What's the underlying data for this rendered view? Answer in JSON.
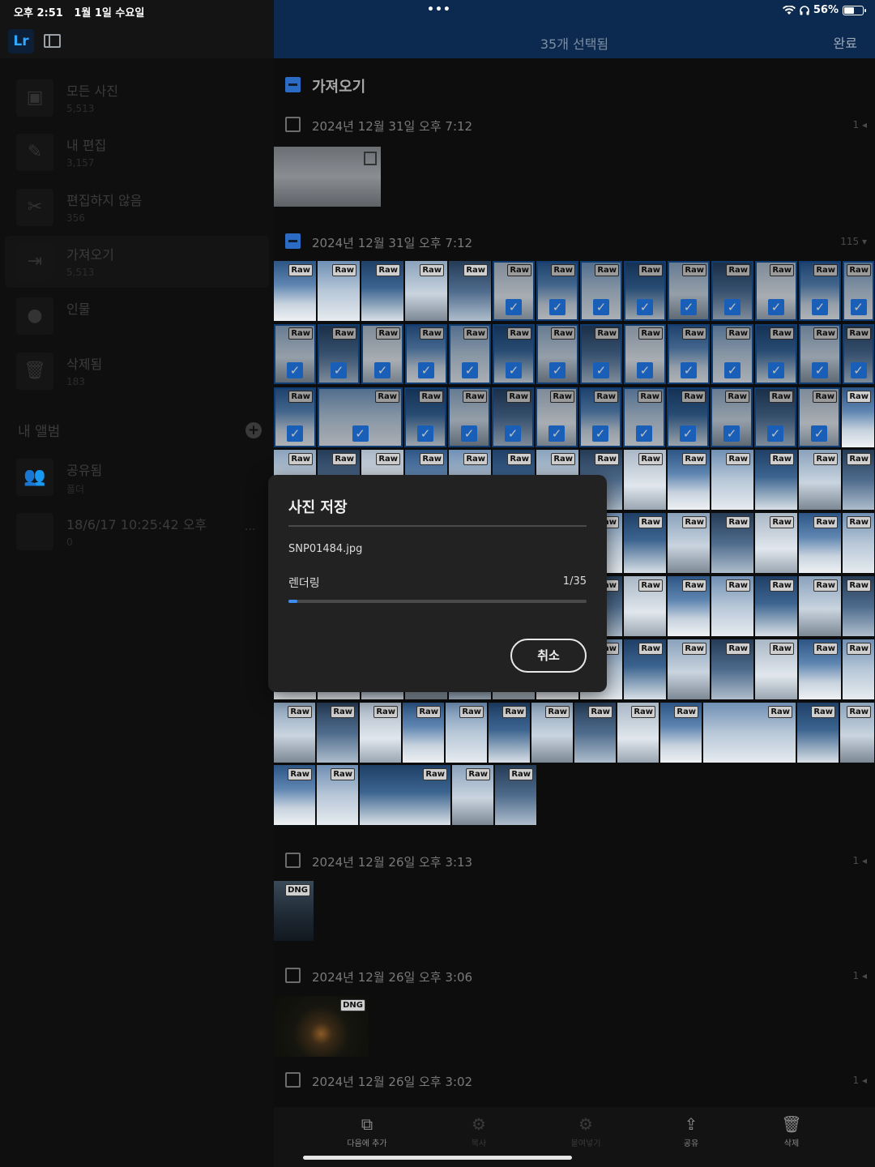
{
  "status_bar": {
    "time": "오후 2:51",
    "date": "1월 1일 수요일",
    "multitask": "•••",
    "battery": "56%",
    "battery_level": 0.56
  },
  "sidebar": {
    "logo": "Lr",
    "items": [
      {
        "label": "모든 사진",
        "count": "5,513",
        "icon": "image-icon",
        "glyph": "▣"
      },
      {
        "label": "내 편집",
        "count": "3,157",
        "icon": "pencil-icon",
        "glyph": "✎"
      },
      {
        "label": "편집하지 않음",
        "count": "356",
        "icon": "no-edit-icon",
        "glyph": "✂"
      },
      {
        "label": "가져오기",
        "count": "5,513",
        "icon": "import-icon",
        "glyph": "⇥"
      },
      {
        "label": "인물",
        "count": "",
        "icon": "person-icon",
        "glyph": "●"
      },
      {
        "label": "삭제됨",
        "count": "183",
        "icon": "trash-icon",
        "glyph": "🗑"
      }
    ],
    "albums_header": "내 앨범",
    "albums": [
      {
        "label": "공유됨",
        "count": "폴더",
        "icon": "shared-icon",
        "glyph": "👥"
      },
      {
        "label": "18/6/17 10:25:42 오후",
        "count": "0",
        "icon": "album-thumb",
        "glyph": ""
      }
    ]
  },
  "header": {
    "title": "35개 선택됨",
    "done": "완료"
  },
  "sections": {
    "import_title": "가져오기",
    "s1": {
      "title": "2024년 12월 31일 오후 7:12",
      "count": "1"
    },
    "s2": {
      "title": "2024년 12월 31일 오후 7:12",
      "count": "115"
    },
    "s3": {
      "title": "2024년 12월 26일 오후 3:13",
      "count": "1"
    },
    "s4": {
      "title": "2024년 12월 26일 오후 3:06",
      "count": "1"
    },
    "s5": {
      "title": "2024년 12월 26일 오후 3:02",
      "count": "1"
    }
  },
  "badges": {
    "raw": "Raw",
    "dng": "DNG"
  },
  "dialog": {
    "title": "사진 저장",
    "filename": "SNP01484.jpg",
    "status": "렌더링",
    "progress_text": "1/35",
    "progress": 0.03,
    "cancel": "취소"
  },
  "toolbar": {
    "items": [
      {
        "label": "다음에 추가",
        "icon": "add-to-icon",
        "glyph": "⧉",
        "enabled": true
      },
      {
        "label": "복사",
        "icon": "copy-settings-icon",
        "glyph": "⚙",
        "enabled": false
      },
      {
        "label": "붙여넣기",
        "icon": "paste-settings-icon",
        "glyph": "⚙",
        "enabled": false
      },
      {
        "label": "공유",
        "icon": "share-icon",
        "glyph": "⇪",
        "enabled": true
      },
      {
        "label": "삭제",
        "icon": "trash-icon",
        "glyph": "🗑",
        "enabled": true
      }
    ]
  },
  "colors": {
    "accent": "#2f7de0",
    "header": "#0c2a4f"
  }
}
